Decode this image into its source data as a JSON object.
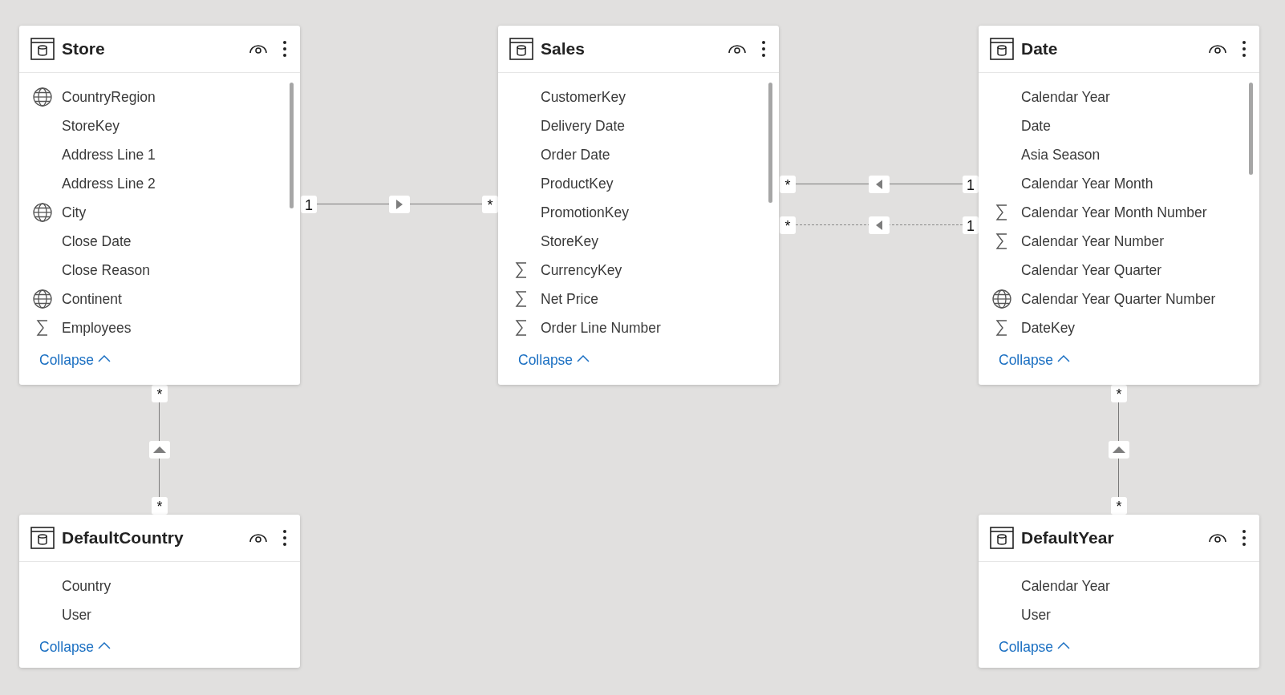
{
  "tables": [
    {
      "name": "Store",
      "fields": [
        {
          "name": "CountryRegion",
          "kind": "geo"
        },
        {
          "name": "StoreKey",
          "kind": "plain"
        },
        {
          "name": "Address Line 1",
          "kind": "plain"
        },
        {
          "name": "Address Line 2",
          "kind": "plain"
        },
        {
          "name": "City",
          "kind": "geo"
        },
        {
          "name": "Close Date",
          "kind": "plain"
        },
        {
          "name": "Close Reason",
          "kind": "plain"
        },
        {
          "name": "Continent",
          "kind": "geo"
        },
        {
          "name": "Employees",
          "kind": "sum"
        }
      ],
      "collapse": "Collapse"
    },
    {
      "name": "Sales",
      "fields": [
        {
          "name": "CustomerKey",
          "kind": "plain"
        },
        {
          "name": "Delivery Date",
          "kind": "plain"
        },
        {
          "name": "Order Date",
          "kind": "plain"
        },
        {
          "name": "ProductKey",
          "kind": "plain"
        },
        {
          "name": "PromotionKey",
          "kind": "plain"
        },
        {
          "name": "StoreKey",
          "kind": "plain"
        },
        {
          "name": "CurrencyKey",
          "kind": "sum"
        },
        {
          "name": "Net Price",
          "kind": "sum"
        },
        {
          "name": "Order Line Number",
          "kind": "sum"
        }
      ],
      "collapse": "Collapse"
    },
    {
      "name": "Date",
      "fields": [
        {
          "name": "Calendar Year",
          "kind": "plain"
        },
        {
          "name": "Date",
          "kind": "plain"
        },
        {
          "name": "Asia Season",
          "kind": "plain"
        },
        {
          "name": "Calendar Year Month",
          "kind": "plain"
        },
        {
          "name": "Calendar Year Month Number",
          "kind": "sum"
        },
        {
          "name": "Calendar Year Number",
          "kind": "sum"
        },
        {
          "name": "Calendar Year Quarter",
          "kind": "plain"
        },
        {
          "name": "Calendar Year Quarter Number",
          "kind": "geo"
        },
        {
          "name": "DateKey",
          "kind": "sum"
        }
      ],
      "collapse": "Collapse"
    },
    {
      "name": "DefaultCountry",
      "fields": [
        {
          "name": "Country",
          "kind": "plain"
        },
        {
          "name": "User",
          "kind": "plain"
        }
      ],
      "collapse": "Collapse"
    },
    {
      "name": "DefaultYear",
      "fields": [
        {
          "name": "Calendar Year",
          "kind": "plain"
        },
        {
          "name": "User",
          "kind": "plain"
        }
      ],
      "collapse": "Collapse"
    }
  ],
  "relationships": [
    {
      "start_end": "1",
      "end_end": "*",
      "kind": "right",
      "active": true
    },
    {
      "start_end": "*",
      "end_end": "1",
      "kind": "left",
      "active": true
    },
    {
      "start_end": "*",
      "end_end": "1",
      "kind": "left",
      "active": false
    },
    {
      "start_end": "*",
      "end_end": "*",
      "kind": "up",
      "active": true
    },
    {
      "start_end": "*",
      "end_end": "*",
      "kind": "up",
      "active": true
    }
  ]
}
